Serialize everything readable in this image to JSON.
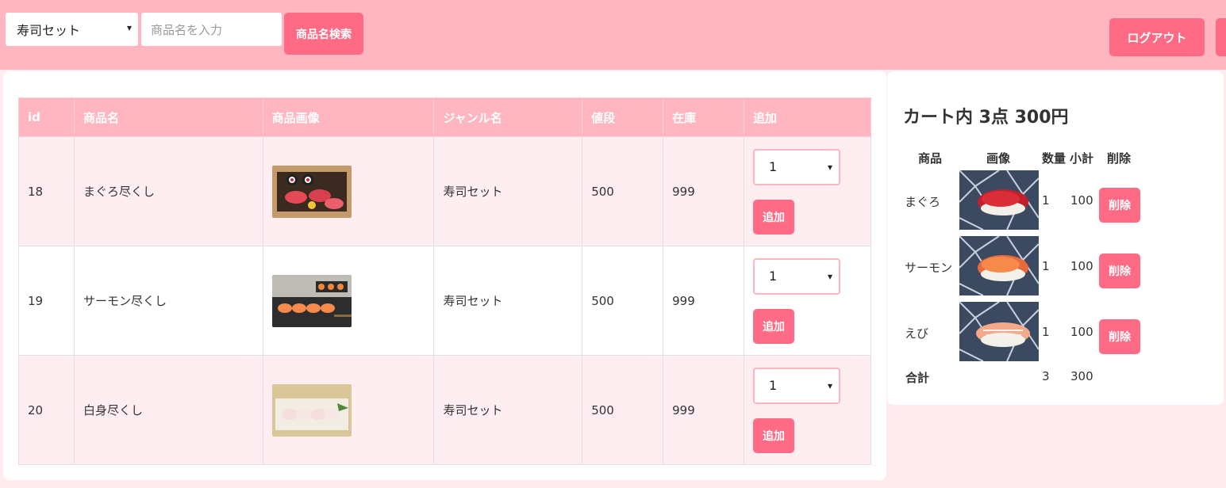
{
  "header": {
    "genre_select": "寿司セット",
    "search_placeholder": "商品名を入力",
    "search_button": "商品名検索",
    "logout_button": "ログアウト"
  },
  "products": {
    "headers": [
      "id",
      "商品名",
      "商品画像",
      "ジャンル名",
      "値段",
      "在庫",
      "追加"
    ],
    "rows": [
      {
        "id": "18",
        "name": "まぐろ尽くし",
        "genre": "寿司セット",
        "price": "500",
        "stock": "999",
        "qty": "1",
        "add": "追加"
      },
      {
        "id": "19",
        "name": "サーモン尽くし",
        "genre": "寿司セット",
        "price": "500",
        "stock": "999",
        "qty": "1",
        "add": "追加"
      },
      {
        "id": "20",
        "name": "白身尽くし",
        "genre": "寿司セット",
        "price": "500",
        "stock": "999",
        "qty": "1",
        "add": "追加"
      }
    ]
  },
  "cart": {
    "title": "カート内 3点 300円",
    "headers": [
      "商品",
      "画像",
      "数量",
      "小計",
      "削除"
    ],
    "items": [
      {
        "name": "まぐろ",
        "qty": "1",
        "subtotal": "100",
        "delete": "削除"
      },
      {
        "name": "サーモン",
        "qty": "1",
        "subtotal": "100",
        "delete": "削除"
      },
      {
        "name": "えび",
        "qty": "1",
        "subtotal": "100",
        "delete": "削除"
      }
    ],
    "total_label": "合計",
    "total_qty": "3",
    "total_amount": "300"
  },
  "colors": {
    "header_bg": "#ffb6c1",
    "button": "#ff6b84",
    "page_bg": "#ffeaee"
  }
}
